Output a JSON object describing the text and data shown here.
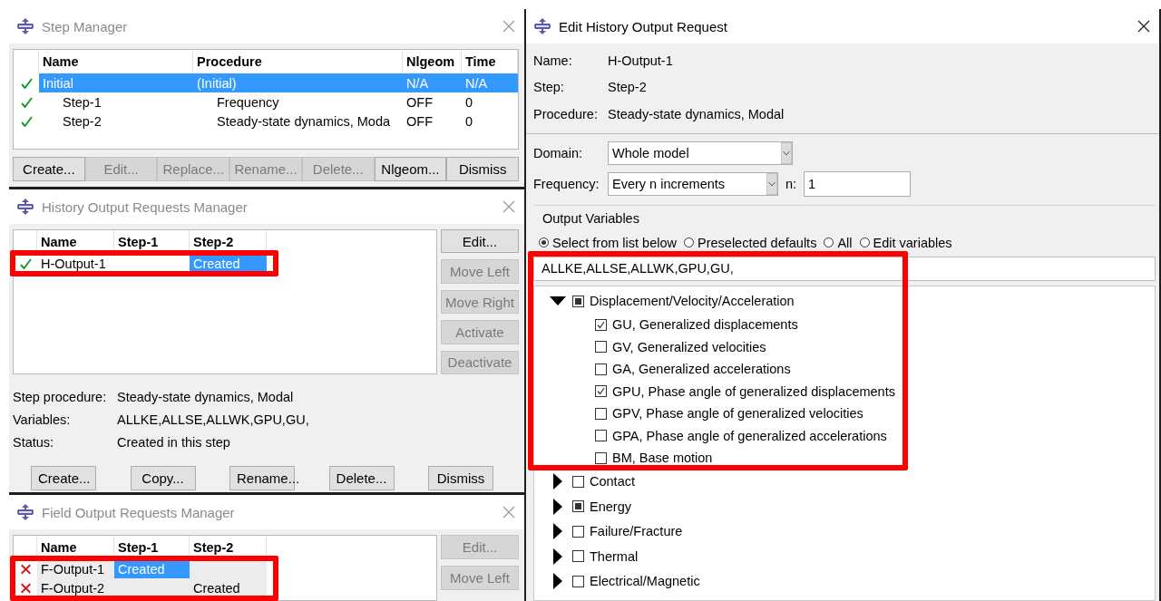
{
  "step_manager": {
    "title": "Step Manager",
    "active": false,
    "columns": [
      "Name",
      "Procedure",
      "Nlgeom",
      "Time"
    ],
    "rows": [
      {
        "kind": "ok",
        "name": "Initial",
        "procedure": "(Initial)",
        "nlgeom": "N/A",
        "time": "N/A",
        "selected": true,
        "children": [
          {
            "kind": "ok",
            "name": "Step-1",
            "procedure": "Frequency",
            "nlgeom": "OFF",
            "time": "0",
            "selected": false
          },
          {
            "kind": "ok",
            "name": "Step-2",
            "procedure": "Steady-state dynamics, Moda",
            "nlgeom": "OFF",
            "time": "0",
            "selected": false
          }
        ]
      }
    ],
    "buttons": [
      {
        "label": "Create...",
        "disabled": false
      },
      {
        "label": "Edit...",
        "disabled": true
      },
      {
        "label": "Replace...",
        "disabled": true
      },
      {
        "label": "Rename...",
        "disabled": true
      },
      {
        "label": "Delete...",
        "disabled": true
      },
      {
        "label": "Nlgeom...",
        "disabled": false
      },
      {
        "label": "Dismiss",
        "disabled": false
      }
    ]
  },
  "history_manager": {
    "title": "History Output Requests Manager",
    "active": false,
    "columns": [
      "Name",
      "Step-1",
      "Step-2"
    ],
    "rows": [
      {
        "kind": "ok",
        "highlighted": true,
        "cells": [
          {
            "text": "H-Output-1",
            "selected": false
          },
          {
            "selected": false
          },
          {
            "text": "Created",
            "selected": true
          }
        ]
      }
    ],
    "side_buttons": [
      {
        "label": "Edit...",
        "disabled": false
      },
      {
        "label": "Move Left",
        "disabled": true
      },
      {
        "label": "Move Right",
        "disabled": true
      },
      {
        "label": "Activate",
        "disabled": true
      },
      {
        "label": "Deactivate",
        "disabled": true
      }
    ],
    "info": [
      {
        "label": "Step procedure:",
        "value": "Steady-state dynamics, Modal"
      },
      {
        "label": "Variables:",
        "value": "ALLKE,ALLSE,ALLWK,GPU,GU,"
      },
      {
        "label": "Status:",
        "value": "Created in this step"
      }
    ],
    "buttons": [
      {
        "label": "Create...",
        "disabled": false
      },
      {
        "label": "Copy...",
        "disabled": false
      },
      {
        "label": "Rename...",
        "disabled": false
      },
      {
        "label": "Delete...",
        "disabled": false
      },
      {
        "label": "Dismiss",
        "disabled": false
      }
    ]
  },
  "field_manager": {
    "title": "Field Output Requests Manager",
    "active": false,
    "columns": [
      "Name",
      "Step-1",
      "Step-2"
    ],
    "rows": [
      {
        "kind": "inactive",
        "highlighted": true,
        "cells": [
          {
            "text": "F-Output-1",
            "selected": false
          },
          {
            "text": "Created",
            "selected": true
          },
          {
            "selected": false
          }
        ]
      },
      {
        "kind": "inactive",
        "highlighted": true,
        "cells": [
          {
            "text": "F-Output-2",
            "selected": false
          },
          {
            "selected": false
          },
          {
            "text": "Created",
            "selected": false
          }
        ]
      }
    ],
    "side_buttons": [
      {
        "label": "Edit...",
        "disabled": true
      },
      {
        "label": "Move Left",
        "disabled": true
      }
    ]
  },
  "edit_dialog": {
    "title": "Edit History Output Request",
    "active": true,
    "info": [
      {
        "label": "Name:",
        "value": "H-Output-1"
      },
      {
        "label": "Step:",
        "value": "Step-2"
      },
      {
        "label": "Procedure:",
        "value": "Steady-state dynamics, Modal"
      }
    ],
    "domain": {
      "label": "Domain:",
      "value": "Whole model"
    },
    "frequency": {
      "label": "Frequency:",
      "value": "Every n increments",
      "n_label": "n:",
      "n_value": "1"
    },
    "group_title": "Output Variables",
    "radios": [
      {
        "label": "Select from list below",
        "selected": true
      },
      {
        "label": "Preselected defaults",
        "selected": false
      },
      {
        "label": "All",
        "selected": false
      },
      {
        "label": "Edit variables",
        "selected": false
      }
    ],
    "variables": {
      "value": "ALLKE,ALLSE,ALLWK,GPU,GU,",
      "highlighted": true
    },
    "tree": [
      {
        "label": "Displacement/Velocity/Acceleration",
        "expanded": true,
        "checked": false,
        "partial": true,
        "highlighted": true,
        "children": [
          {
            "label": "GU, Generalized displacements",
            "checked": true
          },
          {
            "label": "GV, Generalized velocities",
            "checked": false
          },
          {
            "label": "GA, Generalized accelerations",
            "checked": false
          },
          {
            "label": "GPU, Phase angle of generalized displacements",
            "checked": true
          },
          {
            "label": "GPV, Phase angle of generalized velocities",
            "checked": false
          },
          {
            "label": "GPA, Phase angle of generalized accelerations",
            "checked": false
          },
          {
            "label": "BM, Base motion",
            "checked": false
          }
        ]
      },
      {
        "label": "Contact",
        "expanded": false,
        "checked": false,
        "partial": false,
        "highlighted": false
      },
      {
        "label": "Energy",
        "expanded": false,
        "checked": false,
        "partial": true,
        "highlighted": false
      },
      {
        "label": "Failure/Fracture",
        "expanded": false,
        "checked": false,
        "partial": false,
        "highlighted": false
      },
      {
        "label": "Thermal",
        "expanded": false,
        "checked": false,
        "partial": false,
        "highlighted": false
      },
      {
        "label": "Electrical/Magnetic",
        "expanded": false,
        "checked": false,
        "partial": false,
        "highlighted": false
      }
    ]
  }
}
